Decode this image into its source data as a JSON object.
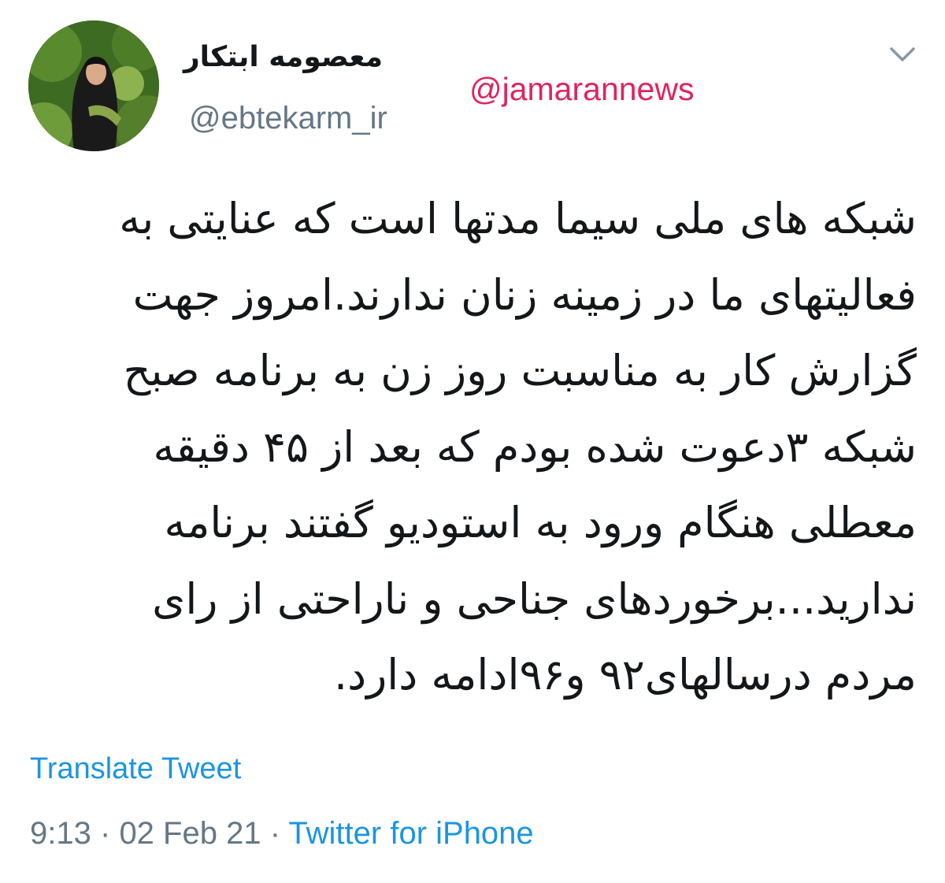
{
  "tweet": {
    "author": {
      "display_name": "معصومه ابتکار",
      "handle": "@ebtekarm_ir",
      "avatar_icon": "profile-photo"
    },
    "watermark": "@jamarannews",
    "menu_icon": "chevron-down-icon",
    "text_lines": [
      "شبکه های ملی سیما مدتها است که عنایتی به",
      "فعالیتهای ما در زمینه زنان ندارند.امروز جهت",
      "گزارش کار به مناسبت روز زن به برنامه صبح",
      "شبکه ۳دعوت شده بودم که بعد از ۴۵ دقیقه",
      "معطلی هنگام ورود به استودیو گفتند برنامه",
      "ندارید...برخوردهای جناحی و ناراحتی از رای",
      "مردم درسالهای۹۲ و۹۶ادامه دارد."
    ],
    "translate_label": "Translate Tweet",
    "time": "9:13",
    "date": "02 Feb 21",
    "separator": "·",
    "source": "Twitter for iPhone"
  },
  "colors": {
    "text_primary": "#14171a",
    "text_secondary": "#657786",
    "link_blue": "#1b95e0",
    "watermark_red": "#e0245e"
  }
}
